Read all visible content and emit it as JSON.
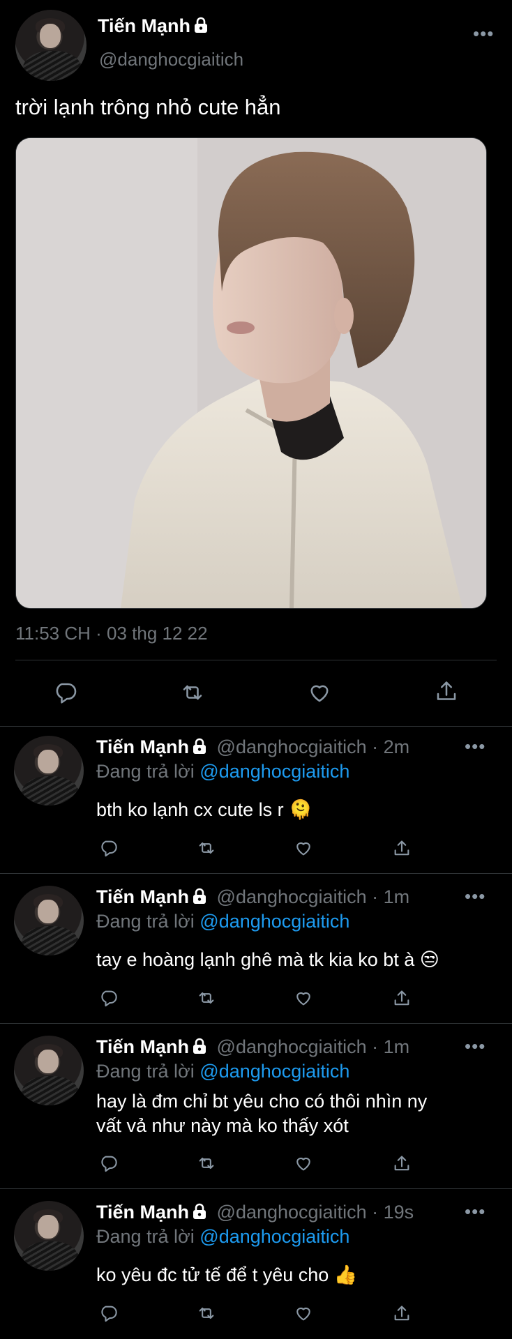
{
  "main_tweet": {
    "display_name": "Tiến Mạnh",
    "handle": "@danghocgiaitich",
    "text": "trời lạnh trông nhỏ cute hẳn",
    "timestamp": "11:53 CH · 03 thg 12 22"
  },
  "replies": [
    {
      "display_name": "Tiến Mạnh",
      "handle": "@danghocgiaitich",
      "time": "· 2m",
      "replying_prefix": "Đang trả lời",
      "replying_to": "@danghocgiaitich",
      "lines": [
        "bth ko lạnh cx cute ls r 🫠"
      ]
    },
    {
      "display_name": "Tiến Mạnh",
      "handle": "@danghocgiaitich",
      "time": "· 1m",
      "replying_prefix": "Đang trả lời",
      "replying_to": "@danghocgiaitich",
      "lines": [
        "tay e hoàng lạnh ghê mà tk kia ko bt à 😒"
      ]
    },
    {
      "display_name": "Tiến Mạnh",
      "handle": "@danghocgiaitich",
      "time": "· 1m",
      "replying_prefix": "Đang trả lời",
      "replying_to": "@danghocgiaitich",
      "lines": [
        "hay là đm chỉ bt yêu cho có thôi nhìn ny",
        "vất vả như này mà ko thấy xót"
      ]
    },
    {
      "display_name": "Tiến Mạnh",
      "handle": "@danghocgiaitich",
      "time": "· 19s",
      "replying_prefix": "Đang trả lời",
      "replying_to": "@danghocgiaitich",
      "lines": [
        "ko yêu đc tử tế để t yêu cho 👍"
      ]
    }
  ],
  "icons": {
    "reply": "speech-bubble-icon",
    "retweet": "retweet-icon",
    "like": "heart-icon",
    "share": "share-icon",
    "more": "more-dots-icon",
    "protected": "lock-icon"
  },
  "colors": {
    "background": "#000000",
    "text": "#ffffff",
    "muted": "#71767b",
    "link": "#1d9bf0",
    "divider": "#2f3336"
  }
}
